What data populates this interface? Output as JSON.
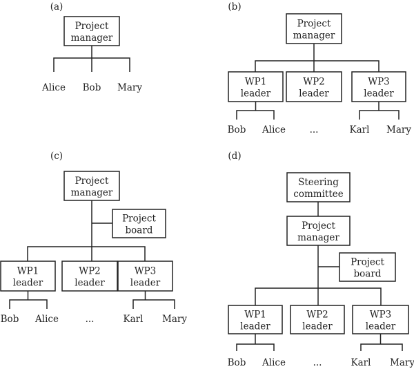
{
  "panels": [
    {
      "label": "(a)",
      "nodes": {
        "pm": [
          "Project",
          "manager"
        ]
      },
      "members": [
        "Alice",
        "Bob",
        "Mary"
      ]
    },
    {
      "label": "(b)",
      "nodes": {
        "pm": [
          "Project",
          "manager"
        ],
        "wp1": [
          "WP1",
          "leader"
        ],
        "wp2": [
          "WP2",
          "leader"
        ],
        "wp3": [
          "WP3",
          "leader"
        ]
      },
      "members": [
        "Bob",
        "Alice",
        "...",
        "Karl",
        "Mary"
      ]
    },
    {
      "label": "(c)",
      "nodes": {
        "pm": [
          "Project",
          "manager"
        ],
        "board": [
          "Project",
          "board"
        ],
        "wp1": [
          "WP1",
          "leader"
        ],
        "wp2": [
          "WP2",
          "leader"
        ],
        "wp3": [
          "WP3",
          "leader"
        ]
      },
      "members": [
        "Bob",
        "Alice",
        "...",
        "Karl",
        "Mary"
      ]
    },
    {
      "label": "(d)",
      "nodes": {
        "steering": [
          "Steering",
          "committee"
        ],
        "pm": [
          "Project",
          "manager"
        ],
        "board": [
          "Project",
          "board"
        ],
        "wp1": [
          "WP1",
          "leader"
        ],
        "wp2": [
          "WP2",
          "leader"
        ],
        "wp3": [
          "WP3",
          "leader"
        ]
      },
      "members": [
        "Bob",
        "Alice",
        "...",
        "Karl",
        "Mary"
      ]
    }
  ]
}
